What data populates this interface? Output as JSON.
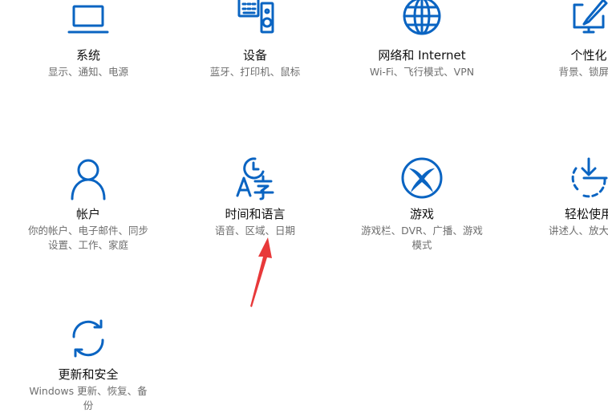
{
  "colors": {
    "accent": "#0a64c2",
    "annotation_arrow": "#e8393a"
  },
  "tiles": [
    {
      "title": "系统",
      "desc": "显示、通知、电源",
      "icon": "laptop-icon"
    },
    {
      "title": "设备",
      "desc": "蓝牙、打印机、鼠标",
      "icon": "keyboard-speaker-icon"
    },
    {
      "title": "网络和 Internet",
      "desc": "Wi-Fi、飞行模式、VPN",
      "icon": "globe-icon"
    },
    {
      "title": "个性化",
      "desc": "背景、锁屏、",
      "icon": "paint-monitor-icon"
    },
    {
      "title": "帐户",
      "desc": "你的帐户、电子邮件、同步\n设置、工作、家庭",
      "icon": "person-icon"
    },
    {
      "title": "时间和语言",
      "desc": "语音、区域、日期",
      "icon": "time-language-icon"
    },
    {
      "title": "游戏",
      "desc": "游戏栏、DVR、广播、游戏\n模式",
      "icon": "xbox-icon"
    },
    {
      "title": "轻松使用",
      "desc": "讲述人、放大镜、",
      "icon": "ease-of-access-icon"
    },
    {
      "title": "更新和安全",
      "desc": "Windows 更新、恢复、备\n份",
      "icon": "sync-icon"
    }
  ]
}
